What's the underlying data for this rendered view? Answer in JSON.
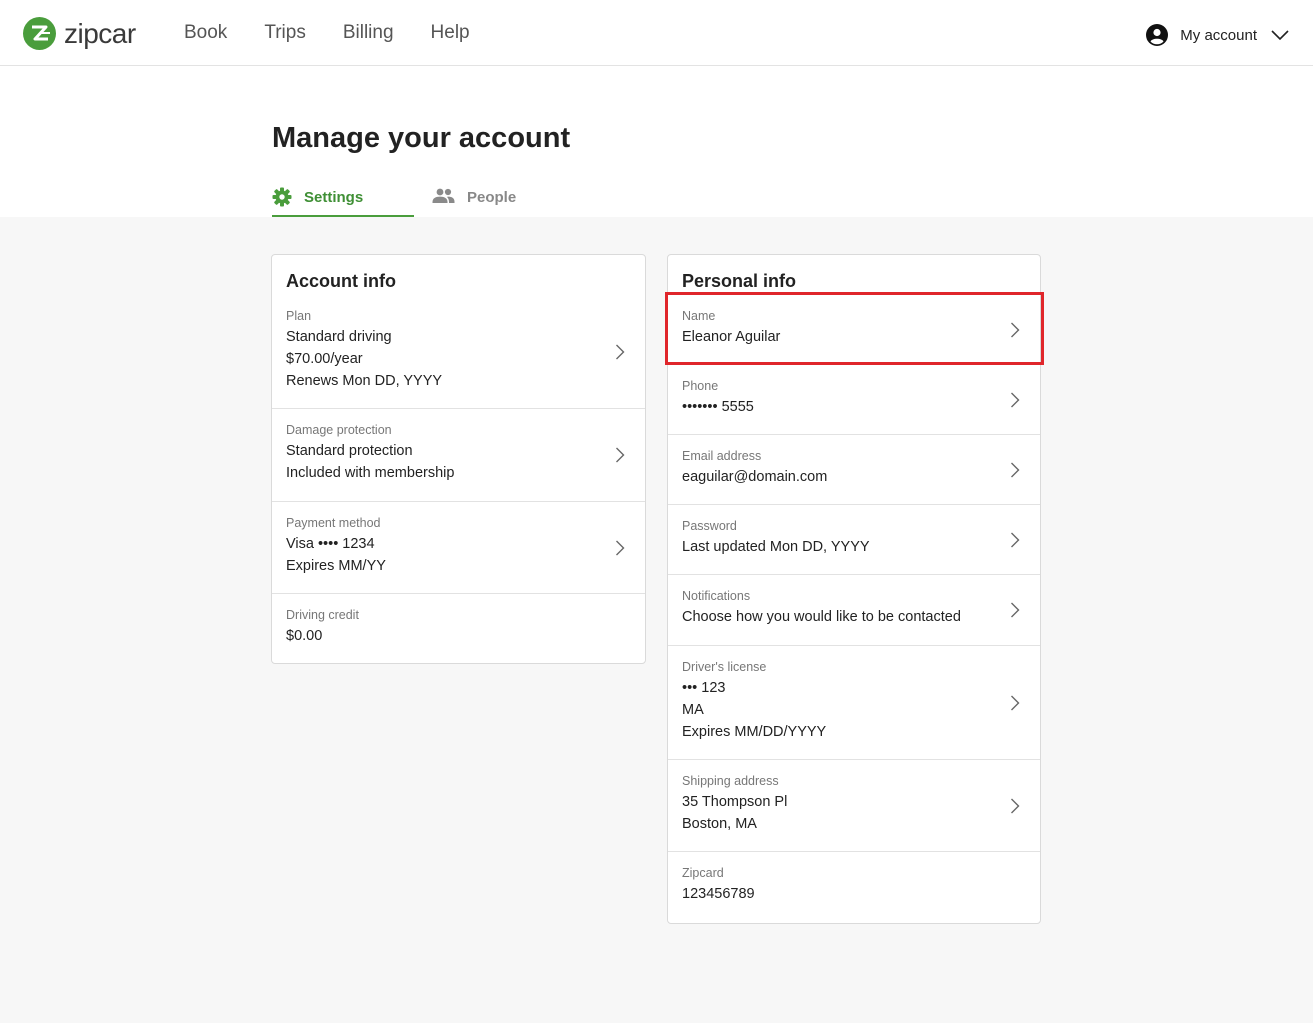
{
  "brand": {
    "name": "zipcar",
    "accent": "#4a9d3c"
  },
  "nav": [
    {
      "label": "Book"
    },
    {
      "label": "Trips"
    },
    {
      "label": "Billing"
    },
    {
      "label": "Help"
    }
  ],
  "account_menu": {
    "label": "My account"
  },
  "page": {
    "title": "Manage your account"
  },
  "tabs": [
    {
      "label": "Settings",
      "icon": "gear-icon",
      "active": true
    },
    {
      "label": "People",
      "icon": "people-icon",
      "active": false
    }
  ],
  "account_info": {
    "title": "Account info",
    "rows": [
      {
        "label": "Plan",
        "lines": [
          "Standard driving",
          "$70.00/year",
          "Renews Mon DD, YYYY"
        ]
      },
      {
        "label": "Damage protection",
        "lines": [
          "Standard protection",
          "Included with membership"
        ]
      },
      {
        "label": "Payment method",
        "lines": [
          "Visa •••• 1234",
          "Expires MM/YY"
        ]
      },
      {
        "label": "Driving credit",
        "lines": [
          "$0.00"
        ]
      }
    ]
  },
  "personal_info": {
    "title": "Personal info",
    "rows": [
      {
        "label": "Name",
        "lines": [
          "Eleanor Aguilar"
        ]
      },
      {
        "label": "Phone",
        "lines": [
          "••••••• 5555"
        ]
      },
      {
        "label": "Email address",
        "lines": [
          "eaguilar@domain.com"
        ]
      },
      {
        "label": "Password",
        "lines": [
          "Last updated Mon DD, YYYY"
        ]
      },
      {
        "label": "Notifications",
        "lines": [
          "Choose how you would like to be contacted"
        ]
      },
      {
        "label": "Driver's license",
        "lines": [
          "••• 123",
          "MA",
          "Expires MM/DD/YYYY"
        ]
      },
      {
        "label": "Shipping address",
        "lines": [
          "35 Thompson Pl",
          "Boston, MA"
        ]
      },
      {
        "label": "Zipcard",
        "lines": [
          "123456789"
        ]
      }
    ]
  },
  "highlight_color": "#e0262b"
}
